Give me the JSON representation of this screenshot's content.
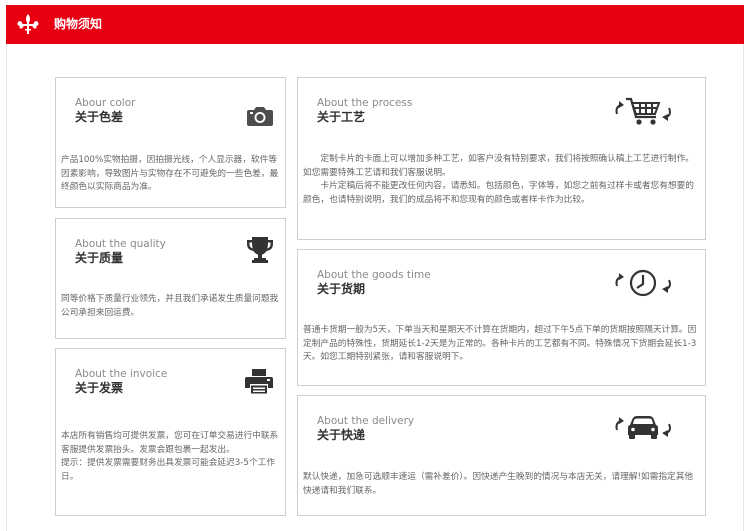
{
  "header": {
    "title": "购物须知",
    "logo": "fleur-de-lis-icon",
    "color": "#e60012"
  },
  "cards": {
    "color": {
      "en": "Abour color",
      "cn": "关于色差",
      "icon": "camera-icon",
      "body": [
        "产品100%实物拍摄，因拍摄光线，个人显示器，软件等因素影响，导致图片与实物存在不可避免的一些色差，最终颜色以实际商品为准。"
      ]
    },
    "quality": {
      "en": "About the quality",
      "cn": "关于质量",
      "icon": "trophy-icon",
      "body": [
        "同等价格下质量行业领先，并且我们承诺发生质量问题我公司承担来回运费。"
      ]
    },
    "invoice": {
      "en": "About the invoice",
      "cn": "关于发票",
      "icon": "printer-icon",
      "body": [
        "本店所有销售均可提供发票，您可在订单交易进行中联系客服提供发票抬头。发票会跟包裹一起发出。",
        "提示：提供发票需要财务出具发票可能会延迟3-5个工作日。"
      ]
    },
    "process": {
      "en": "About the process",
      "cn": "关于工艺",
      "icon": "shopping-cart-icon",
      "body": [
        "　　定制卡片的卡面上可以增加多种工艺，如客户没有特别要求，我们将按照确认稿上工艺进行制作。如您需要特殊工艺请和我们客服说明。",
        "　　卡片定稿后将不能更改任何内容，请悉知。包括颜色，字体等，如您之前有过样卡或者您有想要的颜色，也请特别说明，我们的成品将不和您现有的颜色或者样卡作为比较。"
      ]
    },
    "goods_time": {
      "en": "About the goods time",
      "cn": "关于货期",
      "icon": "clock-icon",
      "body": [
        "普通卡货期一般为5天，下单当天和星期天不计算在货期内，超过下午5点下单的货期按照隔天计算。因定制产品的特殊性，货期延长1-2天是为正常的。各种卡片的工艺都有不同。特殊情况下货期会延长1-3天。如您工期特别紧张，请和客服说明下。"
      ]
    },
    "delivery": {
      "en": "About the delivery",
      "cn": "关于快递",
      "icon": "car-icon",
      "body": [
        "默认快递，加急可选顺丰速运（需补差价）。因快递产生晚到的情况与本店无关，请理解!如需指定其他快递请和我们联系。"
      ]
    }
  }
}
